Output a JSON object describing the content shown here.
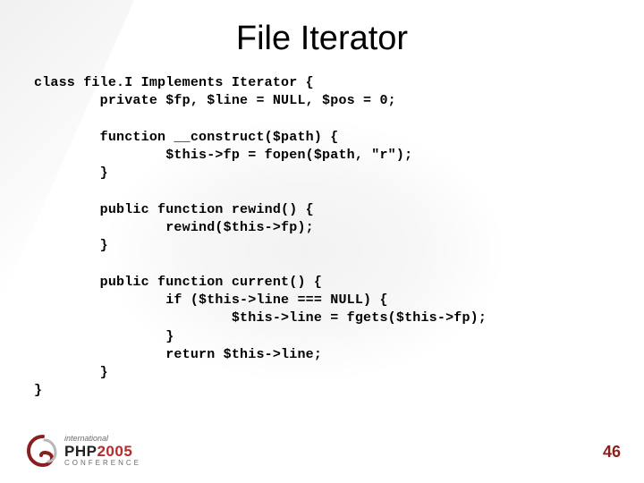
{
  "title": "File Iterator",
  "code": "class file.I Implements Iterator {\n        private $fp, $line = NULL, $pos = 0;\n\n        function __construct($path) {\n                $this->fp = fopen($path, \"r\");\n        }\n\n        public function rewind() {\n                rewind($this->fp);\n        }\n\n        public function current() {\n                if ($this->line === NULL) {\n                        $this->line = fgets($this->fp);\n                }\n                return $this->line;\n        }\n}",
  "logo": {
    "line1": "international",
    "brand": "PHP",
    "year": "2005",
    "line3": "CONFERENCE"
  },
  "page_number": "46"
}
